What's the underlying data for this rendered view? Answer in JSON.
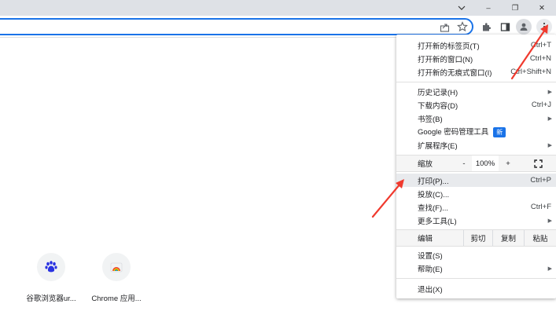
{
  "titlebar": {
    "chevron_icon": "chevron-down-icon",
    "minimize": "–",
    "restore": "❐",
    "close": "✕"
  },
  "tiles": [
    {
      "label": "谷歌浏览器ur...",
      "icon": "baidu-paw-icon",
      "color": "#2932e1"
    },
    {
      "label": "Chrome 应用...",
      "icon": "chrome-webstore-icon",
      "color": "#ea4335"
    }
  ],
  "menu": {
    "new_tab": {
      "label": "打开新的标签页(T)",
      "shortcut": "Ctrl+T"
    },
    "new_window": {
      "label": "打开新的窗口(N)",
      "shortcut": "Ctrl+N"
    },
    "incognito": {
      "label": "打开新的无痕式窗口(I)",
      "shortcut": "Ctrl+Shift+N"
    },
    "history": {
      "label": "历史记录(H)"
    },
    "downloads": {
      "label": "下载内容(D)",
      "shortcut": "Ctrl+J"
    },
    "bookmarks": {
      "label": "书签(B)"
    },
    "password_manager": {
      "label": "Google 密码管理工具",
      "badge": "新"
    },
    "extensions": {
      "label": "扩展程序(E)"
    },
    "zoom": {
      "label": "缩放",
      "minus": "-",
      "value": "100%",
      "plus": "+"
    },
    "print": {
      "label": "打印(P)...",
      "shortcut": "Ctrl+P"
    },
    "cast": {
      "label": "投放(C)..."
    },
    "find": {
      "label": "查找(F)...",
      "shortcut": "Ctrl+F"
    },
    "more_tools": {
      "label": "更多工具(L)"
    },
    "edit": {
      "label": "编辑",
      "cut": "剪切",
      "copy": "复制",
      "paste": "粘贴"
    },
    "settings": {
      "label": "设置(S)"
    },
    "help": {
      "label": "帮助(E)"
    },
    "exit": {
      "label": "退出(X)"
    }
  },
  "annotation_color": "#f03a2e"
}
